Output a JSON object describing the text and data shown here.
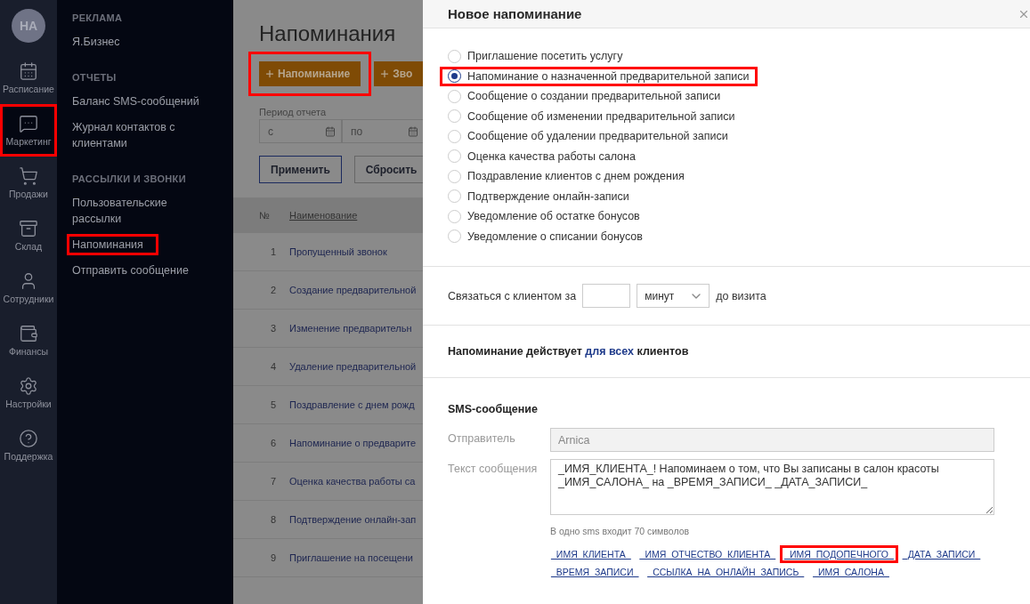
{
  "rail": {
    "avatar": "НА",
    "items": [
      {
        "label": "Расписание",
        "selected": false,
        "highlighted": false
      },
      {
        "label": "Маркетинг",
        "selected": true,
        "highlighted": true
      },
      {
        "label": "Продажи",
        "selected": false,
        "highlighted": false
      },
      {
        "label": "Склад",
        "selected": false,
        "highlighted": false
      },
      {
        "label": "Сотрудники",
        "selected": false,
        "highlighted": false
      },
      {
        "label": "Финансы",
        "selected": false,
        "highlighted": false
      },
      {
        "label": "Настройки",
        "selected": false,
        "highlighted": false
      },
      {
        "label": "Поддержка",
        "selected": false,
        "highlighted": false
      }
    ]
  },
  "submenu": {
    "sections": [
      {
        "heading": "РЕКЛАМА",
        "items": [
          {
            "label": "Я.Бизнес",
            "highlighted": false
          }
        ]
      },
      {
        "heading": "ОТЧЕТЫ",
        "items": [
          {
            "label": "Баланс SMS-сообщений",
            "highlighted": false
          },
          {
            "label": "Журнал контактов с клиентами",
            "highlighted": false
          }
        ]
      },
      {
        "heading": "РАССЫЛКИ И ЗВОНКИ",
        "items": [
          {
            "label": "Пользовательские рассылки",
            "highlighted": false
          },
          {
            "label": "Напоминания",
            "highlighted": true
          },
          {
            "label": "Отправить сообщение",
            "highlighted": false
          }
        ]
      }
    ]
  },
  "main": {
    "title": "Напоминания",
    "buttons": [
      {
        "label": "Напоминание",
        "highlighted": true
      },
      {
        "label": "Зво",
        "highlighted": false
      }
    ],
    "period": {
      "label": "Период отчета",
      "from_placeholder": "с",
      "to_placeholder": "по"
    },
    "apply": "Применить",
    "reset": "Сбросить",
    "table": {
      "columns": [
        "№",
        "Наименование"
      ],
      "rows": [
        [
          "1",
          "Пропущенный звонок"
        ],
        [
          "2",
          "Создание предварительной"
        ],
        [
          "3",
          "Изменение предварительн"
        ],
        [
          "4",
          "Удаление предварительной"
        ],
        [
          "5",
          "Поздравление с днем рожд"
        ],
        [
          "6",
          "Напоминание о предварите"
        ],
        [
          "7",
          "Оценка качества работы са"
        ],
        [
          "8",
          "Подтверждение онлайн-зап"
        ],
        [
          "9",
          "Приглашение на посещени"
        ]
      ]
    }
  },
  "panel": {
    "title": "Новое напоминание",
    "options": [
      {
        "label": "Приглашение посетить услугу",
        "selected": false,
        "highlighted": false
      },
      {
        "label": "Напоминание о назначенной предварительной записи",
        "selected": true,
        "highlighted": true
      },
      {
        "label": "Сообщение о создании предварительной записи",
        "selected": false,
        "highlighted": false
      },
      {
        "label": "Сообщение об изменении предварительной записи",
        "selected": false,
        "highlighted": false
      },
      {
        "label": "Сообщение об удалении предварительной записи",
        "selected": false,
        "highlighted": false
      },
      {
        "label": "Оценка качества работы салона",
        "selected": false,
        "highlighted": false
      },
      {
        "label": "Поздравление клиентов с днем рождения",
        "selected": false,
        "highlighted": false
      },
      {
        "label": "Подтверждение онлайн-записи",
        "selected": false,
        "highlighted": false
      },
      {
        "label": "Уведомление об остатке бонусов",
        "selected": false,
        "highlighted": false
      },
      {
        "label": "Уведомление о списании бонусов",
        "selected": false,
        "highlighted": false
      }
    ],
    "contact": {
      "prefix": "Связаться с клиентом за",
      "unit": "минут",
      "suffix": "до визита"
    },
    "scope": {
      "before": "Напоминание действует",
      "link": "для всех",
      "after": "клиентов"
    },
    "sms": {
      "heading": "SMS-сообщение",
      "sender_label": "Отправитель",
      "sender_value": "Arnica",
      "text_label": "Текст сообщения",
      "text_value": "_ИМЯ_КЛИЕНТА_! Напоминаем о том, что Вы записаны в салон красоты _ИМЯ_САЛОНА_ на _ВРЕМЯ_ЗАПИСИ_ _ДАТА_ЗАПИСИ_",
      "hint": "В одно sms входит 70 символов",
      "variables": [
        {
          "label": "_ИМЯ_КЛИЕНТА_",
          "highlighted": false
        },
        {
          "label": "_ИМЯ_ОТЧЕСТВО_КЛИЕНТА_",
          "highlighted": false
        },
        {
          "label": "_ИМЯ_ПОДОПЕЧНОГО_",
          "highlighted": true
        },
        {
          "label": "_ДАТА_ЗАПИСИ_",
          "highlighted": false
        },
        {
          "label": "_ВРЕМЯ_ЗАПИСИ_",
          "highlighted": false
        },
        {
          "label": "_ССЫЛКА_НА_ОНЛАЙН_ЗАПИСЬ_",
          "highlighted": false
        },
        {
          "label": "_ИМЯ_САЛОНА_",
          "highlighted": false
        }
      ]
    }
  }
}
